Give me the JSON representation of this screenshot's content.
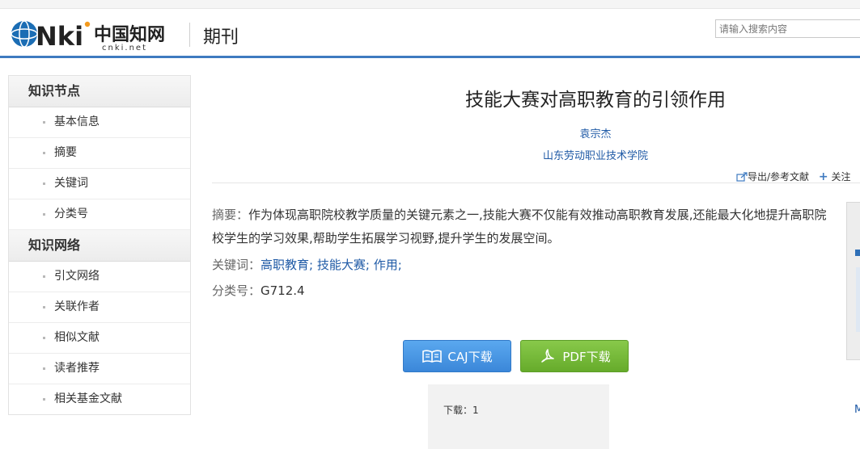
{
  "header": {
    "logo_text": "CNKi中国知网",
    "logo_sub": "cnki.net",
    "section_title": "期刊",
    "search_placeholder": "请输入搜索内容"
  },
  "sidebar": {
    "groups": [
      {
        "title": "知识节点",
        "items": [
          "基本信息",
          "摘要",
          "关键词",
          "分类号"
        ]
      },
      {
        "title": "知识网络",
        "items": [
          "引文网络",
          "关联作者",
          "相似文献",
          "读者推荐",
          "相关基金文献"
        ]
      }
    ]
  },
  "article": {
    "title": "技能大赛对高职教育的引领作用",
    "author": "袁宗杰",
    "organization": "山东劳动职业技术学院",
    "tools": {
      "export": "导出/参考文献",
      "follow": "关注"
    },
    "abstract_label": "摘要：",
    "abstract": "作为体现高职院校教学质量的关键元素之一,技能大赛不仅能有效推动高职教育发展,还能最大化地提升高职院校学生的学习效果,帮助学生拓展学习视野,提升学生的发展空间。",
    "keywords_label": "关键词：",
    "keywords": [
      "高职教育;",
      "技能大赛;",
      "作用;"
    ],
    "classification_label": "分类号：",
    "classification": "G712.4"
  },
  "downloads": {
    "caj_label": "CAJ下载",
    "pdf_label": "PDF下载",
    "count_label": "下载：",
    "count": "1"
  },
  "right_edge": {
    "letter": "M"
  },
  "colors": {
    "accent": "#3e7ac0",
    "link": "#1f5aa6",
    "caj_button": "#3b87d9",
    "pdf_button": "#66ab2b"
  }
}
